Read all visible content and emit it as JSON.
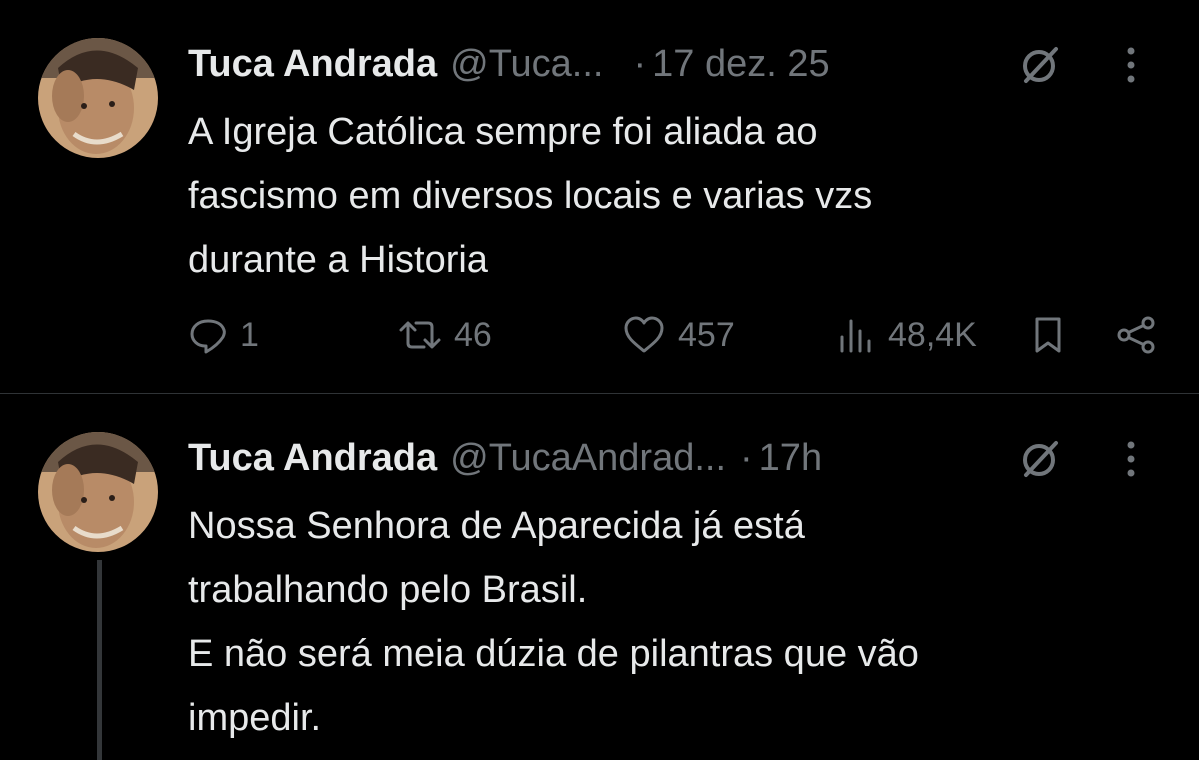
{
  "tweets": [
    {
      "author": {
        "name": "Tuca Andrada",
        "handle": "@Tuca...",
        "avatar_icon": "profile-photo"
      },
      "separator": "·",
      "timestamp": "17 dez. 25",
      "text_lines": [
        "A Igreja Católica sempre foi aliada ao",
        "fascismo em diversos locais e varias vzs",
        "durante a Historia"
      ],
      "actions": {
        "replies": "1",
        "retweets": "46",
        "likes": "457",
        "views": "48,4K"
      }
    },
    {
      "author": {
        "name": "Tuca Andrada",
        "handle": "@TucaAndrad...",
        "avatar_icon": "profile-photo"
      },
      "separator": "·",
      "timestamp": "17h",
      "text_lines": [
        "Nossa Senhora de Aparecida já está",
        "trabalhando pelo Brasil.",
        "E não será meia dúzia de pilantras que vão",
        "impedir."
      ]
    }
  ],
  "colors": {
    "background": "#000000",
    "text_primary": "#e7e9ea",
    "text_secondary": "#71767b",
    "divider": "#2f3336",
    "thread_line": "#333639"
  }
}
